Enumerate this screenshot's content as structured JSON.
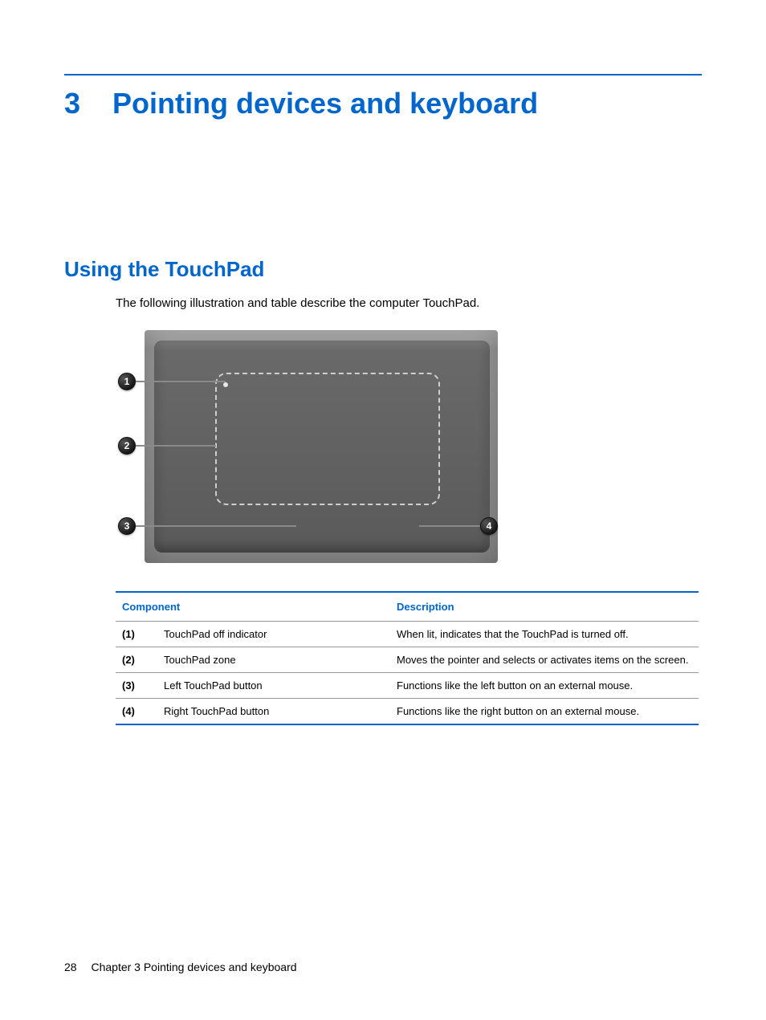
{
  "chapter": {
    "number": "3",
    "title": "Pointing devices and keyboard"
  },
  "section": {
    "heading": "Using the TouchPad",
    "intro": "The following illustration and table describe the computer TouchPad."
  },
  "callouts": {
    "c1": "1",
    "c2": "2",
    "c3": "3",
    "c4": "4"
  },
  "table": {
    "headers": {
      "component": "Component",
      "description": "Description"
    },
    "rows": [
      {
        "num": "(1)",
        "name": "TouchPad off indicator",
        "desc": "When lit, indicates that the TouchPad is turned off."
      },
      {
        "num": "(2)",
        "name": "TouchPad zone",
        "desc": "Moves the pointer and selects or activates items on the screen."
      },
      {
        "num": "(3)",
        "name": "Left TouchPad button",
        "desc": "Functions like the left button on an external mouse."
      },
      {
        "num": "(4)",
        "name": "Right TouchPad button",
        "desc": "Functions like the right button on an external mouse."
      }
    ]
  },
  "footer": {
    "page": "28",
    "chapter_label": "Chapter 3   Pointing devices and keyboard"
  }
}
